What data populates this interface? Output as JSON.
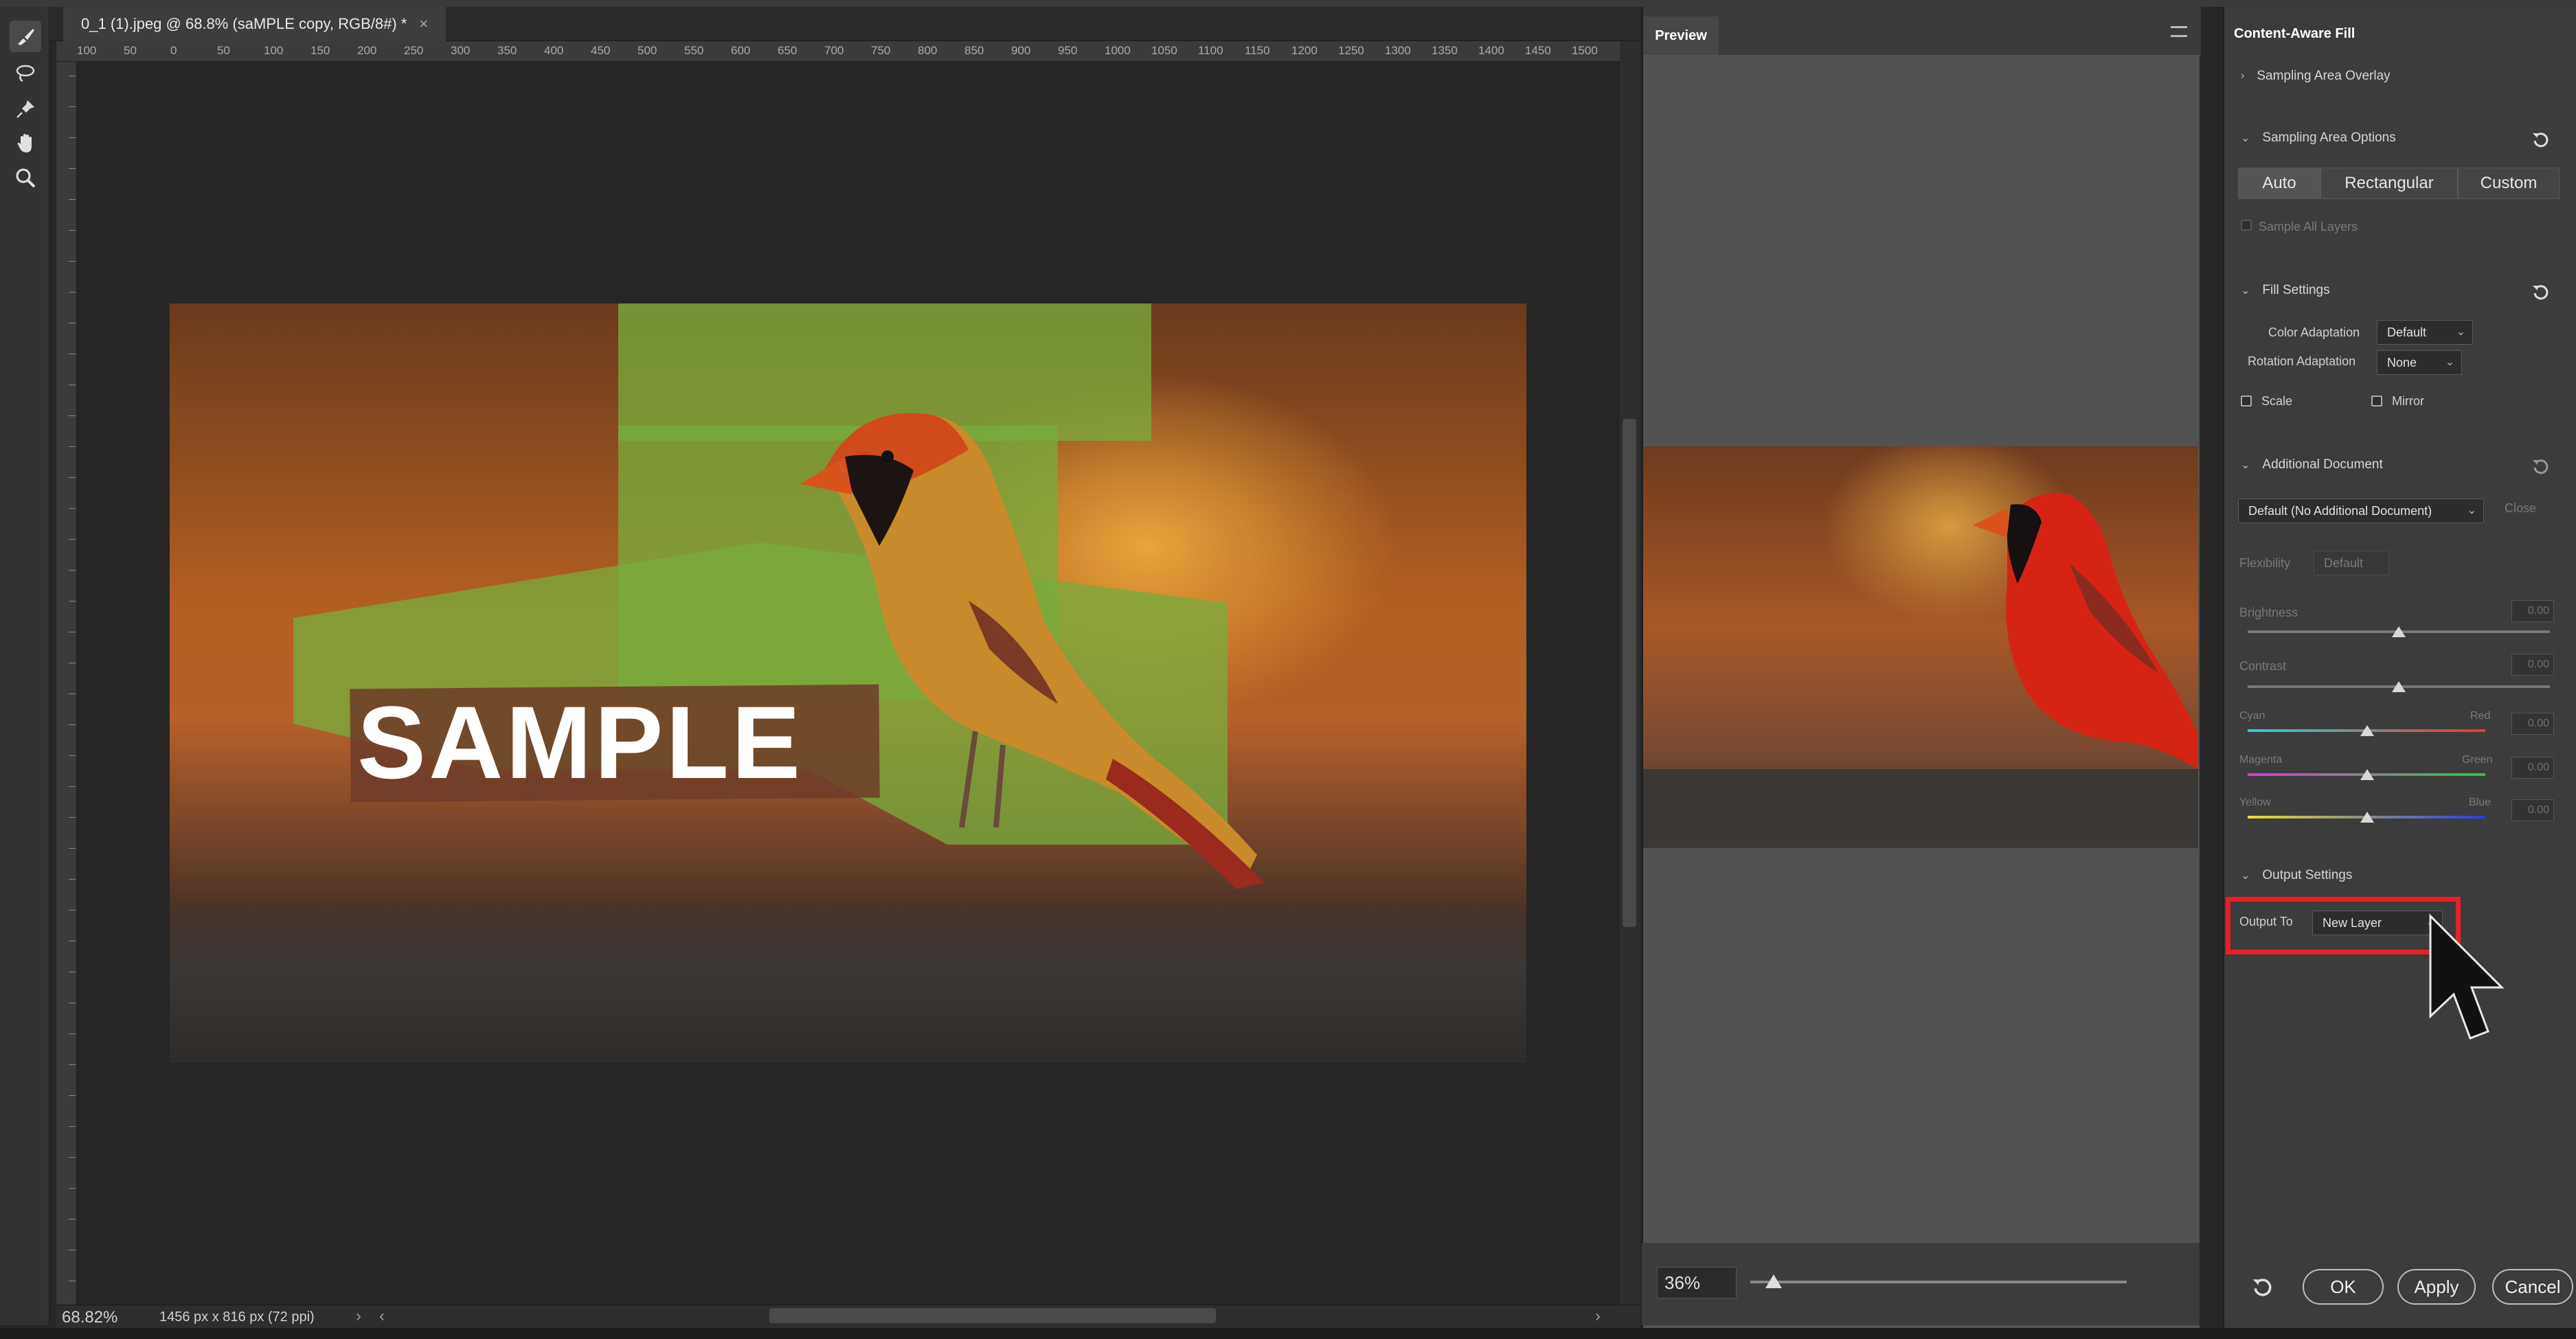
{
  "document": {
    "tab_title": "0_1 (1).jpeg @ 68.8% (saMPLE copy, RGB/8#) *",
    "tab_close": "×",
    "ruler_marks": [
      "100",
      "50",
      "0",
      "50",
      "100",
      "150",
      "200",
      "250",
      "300",
      "350",
      "400",
      "450",
      "500",
      "550",
      "600",
      "650",
      "700",
      "750",
      "800",
      "850",
      "900",
      "950",
      "1000",
      "1050",
      "1100",
      "1150",
      "1200",
      "1250",
      "1300",
      "1350",
      "1400",
      "1450",
      "1500"
    ],
    "watermark_text": "SAMPLE",
    "zoom_status": "68.82%",
    "doc_info": "1456 px x 816 px (72 ppi)"
  },
  "tools": [
    "brush-tool",
    "lasso-tool",
    "pin-tool",
    "hand-tool",
    "zoom-tool"
  ],
  "preview": {
    "tab_label": "Preview",
    "zoom_value": "36%",
    "zoom_fraction": 0.04
  },
  "panel": {
    "title": "Content-Aware Fill",
    "sampling_overlay": "Sampling Area Overlay",
    "sampling_options": "Sampling Area Options",
    "seg_auto": "Auto",
    "seg_rect": "Rectangular",
    "seg_custom": "Custom",
    "sample_all_layers": "Sample All Layers",
    "fill_settings": "Fill Settings",
    "color_adaptation_label": "Color Adaptation",
    "color_adaptation_value": "Default",
    "rotation_adaptation_label": "Rotation Adaptation",
    "rotation_adaptation_value": "None",
    "scale_label": "Scale",
    "mirror_label": "Mirror",
    "additional_document": "Additional Document",
    "additional_doc_value": "Default (No Additional Document)",
    "close_label": "Close",
    "flexibility_label": "Flexibility",
    "flexibility_value": "Default",
    "brightness_label": "Brightness",
    "brightness_value": "0.00",
    "contrast_label": "Contrast",
    "contrast_value": "0.00",
    "cyan_label": "Cyan",
    "red_label": "Red",
    "cyan_value": "0.00",
    "magenta_label": "Magenta",
    "green_label": "Green",
    "magenta_value": "0.00",
    "yellow_label": "Yellow",
    "blue_label": "Blue",
    "yellow_value": "0.00",
    "output_settings": "Output Settings",
    "output_to_label": "Output To",
    "output_to_value": "New Layer",
    "ok_label": "OK",
    "apply_label": "Apply",
    "cancel_label": "Cancel"
  },
  "colors": {
    "highlight": "#e8202a",
    "panel_bg": "#3c3c3c",
    "canvas_bg": "#262626",
    "overlay_green": "#78aa3c"
  }
}
